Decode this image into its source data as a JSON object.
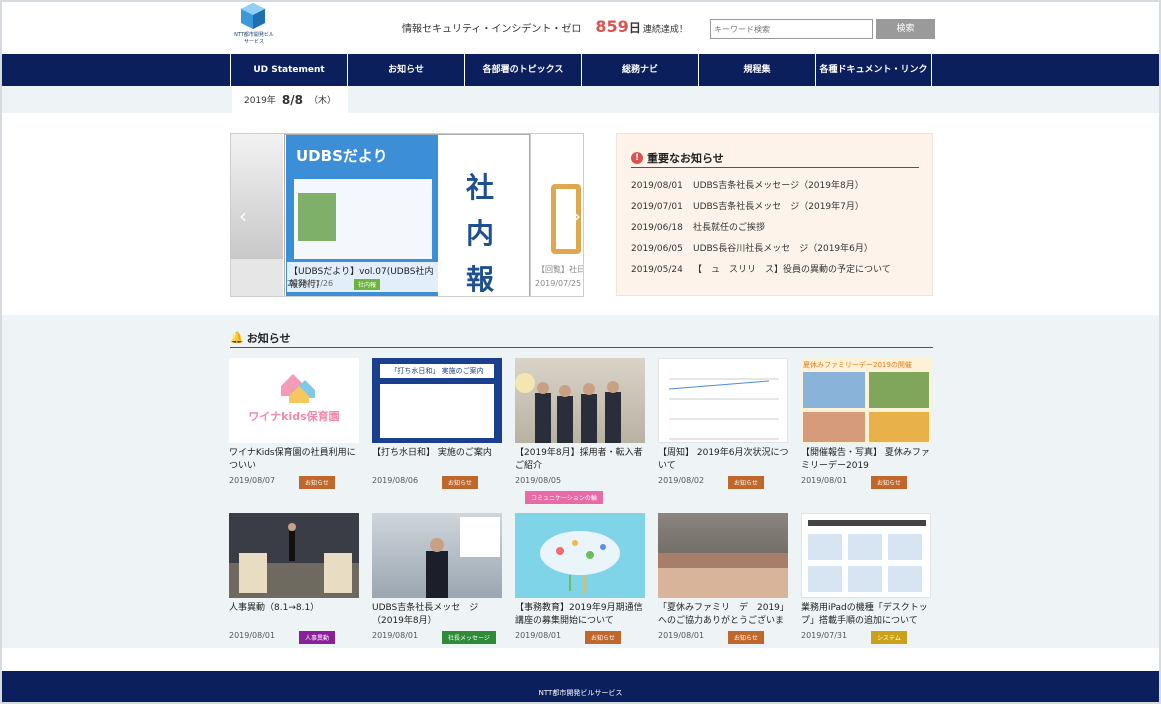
{
  "header": {
    "logo_text": "NTT都市開発ビルサービス",
    "security_text": "情報セキュリティ・インシデント・ゼロ",
    "security_days": "859",
    "security_unit": "日",
    "security_suffix": "連続達成！",
    "search_placeholder": "キーワード検索",
    "search_button": "検索"
  },
  "nav": {
    "items": [
      "UD Statement",
      "お知らせ",
      "各部署のトピックス",
      "総務ナビ",
      "規程集",
      "各種ドキュメント・リンク"
    ]
  },
  "date": {
    "year": "2019年",
    "md": "8/8",
    "weekday": "（木）"
  },
  "slider": {
    "main_cover_title": "UDBSだより",
    "main_kanji": "社内報",
    "main_caption": "【UDBSだより】vol.07(UDBS社内報発行)",
    "main_date": "2019/07/26",
    "main_tag": "社内報",
    "right_caption": "【回覧】社日",
    "right_date": "2019/07/25",
    "prev_icon": "‹",
    "next_icon": "›"
  },
  "important": {
    "title": "重要なお知らせ",
    "icon": "!",
    "items": [
      {
        "date": "2019/08/01",
        "text": "UDBS吉条社長メッセージ（2019年8月）"
      },
      {
        "date": "2019/07/01",
        "text": "UDBS吉条社長メッセ　ジ（2019年7月）"
      },
      {
        "date": "2019/06/18",
        "text": "社長就任のご挨拶"
      },
      {
        "date": "2019/06/05",
        "text": "UDBS長谷川社長メッセ　ジ（2019年6月）"
      },
      {
        "date": "2019/05/24",
        "text": "【　ュ　スリリ　ス】役員の異動の予定について"
      }
    ]
  },
  "news": {
    "title": "お知らせ",
    "icon": "🔔",
    "cards": [
      {
        "caption": "ワイナKids保育園の社員利用についい",
        "date": "2019/08/07",
        "tag": "お知らせ",
        "tag_color": "#c0672b",
        "thumb_text": "ワイナkids保育園"
      },
      {
        "caption": "【打ち水日和】 実施のご案内",
        "date": "2019/08/06",
        "tag": "お知らせ",
        "tag_color": "#c0672b",
        "thumb_text": "「打ち水日和」 実施のご案内"
      },
      {
        "caption": "【2019年8月】採用者・転入者ご紹介",
        "date": "2019/08/05",
        "tag": "コミュニケーションの輪",
        "tag_color": "#e86aa6",
        "thumb_text": ""
      },
      {
        "caption": "【周知】 2019年6月次状況について",
        "date": "2019/08/02",
        "tag": "お知らせ",
        "tag_color": "#c0672b",
        "thumb_text": ""
      },
      {
        "caption": "【開催報告・写真】 夏休みファミリーデー2019",
        "date": "2019/08/01",
        "tag": "お知らせ",
        "tag_color": "#c0672b",
        "thumb_text": "夏休みファミリーデー2019の開催"
      },
      {
        "caption": "人事異動（8.1→8.1）",
        "date": "2019/08/01",
        "tag": "人事異動",
        "tag_color": "#8a1f9a",
        "thumb_text": ""
      },
      {
        "caption": "UDBS吉条社長メッセ　ジ（2019年8月）",
        "date": "2019/08/01",
        "tag": "社長メッセージ",
        "tag_color": "#2e8b3a",
        "thumb_text": ""
      },
      {
        "caption": "【事務教育】2019年9月期通信講座の募集開始について",
        "date": "2019/08/01",
        "tag": "お知らせ",
        "tag_color": "#c0672b",
        "thumb_text": ""
      },
      {
        "caption": "「夏休みファミリ　デ　2019」へのご協力ありがとうございました",
        "date": "2019/08/01",
        "tag": "お知らせ",
        "tag_color": "#c0672b",
        "thumb_text": ""
      },
      {
        "caption": "業務用iPadの機種「デスクトップ」搭載手順の追加について",
        "date": "2019/07/31",
        "tag": "システム",
        "tag_color": "#c9a21a",
        "thumb_text": ""
      }
    ]
  },
  "footer": {
    "text": "NTT都市開発ビルサービス"
  }
}
